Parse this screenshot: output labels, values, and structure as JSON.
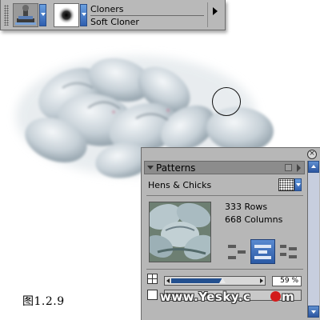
{
  "brush_selector": {
    "category": "Cloners",
    "variant": "Soft Cloner"
  },
  "figure_caption": "图1.2.9",
  "patterns_palette": {
    "title": "Patterns",
    "pattern_name": "Hens & Chicks",
    "rows": "333 Rows",
    "columns": "668 Columns",
    "offset_percent": "59 %",
    "offset_value": 0.59
  },
  "watermark": "www.Yesky.c",
  "watermark_tail": "m",
  "colors": {
    "panel_gray": "#b7b7b7",
    "accent_blue": "#2f5fb0",
    "slider_fill": "#23508f"
  }
}
